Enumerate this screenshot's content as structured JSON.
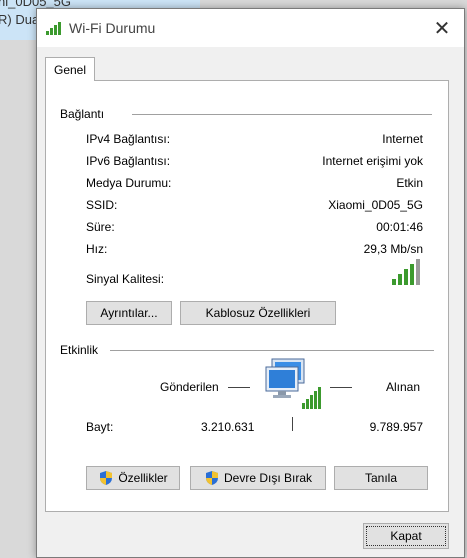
{
  "background": {
    "line1": "ni_0D05_5G",
    "line2": "R) Dua"
  },
  "window": {
    "title": "Wi-Fi Durumu",
    "close_label": "✕"
  },
  "tabs": [
    {
      "label": "Genel",
      "active": true
    }
  ],
  "connection": {
    "section_label": "Bağlantı",
    "rows": [
      {
        "label": "IPv4 Bağlantısı:",
        "value": "Internet"
      },
      {
        "label": "IPv6 Bağlantısı:",
        "value": "Internet erişimi yok"
      },
      {
        "label": "Medya Durumu:",
        "value": "Etkin"
      },
      {
        "label": "SSID:",
        "value": "Xiaomi_0D05_5G"
      },
      {
        "label": "Süre:",
        "value": "00:01:46"
      },
      {
        "label": "Hız:",
        "value": "29,3 Mb/sn"
      }
    ],
    "signal_label": "Sinyal Kalitesi:",
    "signal_bars": 5,
    "signal_strength": 4,
    "details_button": "Ayrıntılar...",
    "wireless_properties_button": "Kablosuz Özellikleri"
  },
  "activity": {
    "section_label": "Etkinlik",
    "sent_label": "Gönderilen",
    "received_label": "Alınan",
    "bytes_label": "Bayt:",
    "bytes_sent": "3.210.631",
    "bytes_received": "9.789.957"
  },
  "actions": {
    "properties_button": "Özellikler",
    "disable_button": "Devre Dışı Bırak",
    "diagnose_button": "Tanıla"
  },
  "footer": {
    "close_button": "Kapat"
  },
  "colors": {
    "signal_green": "#3c9a2e",
    "shield_blue": "#2a6fd6",
    "shield_yellow": "#f2c230"
  }
}
